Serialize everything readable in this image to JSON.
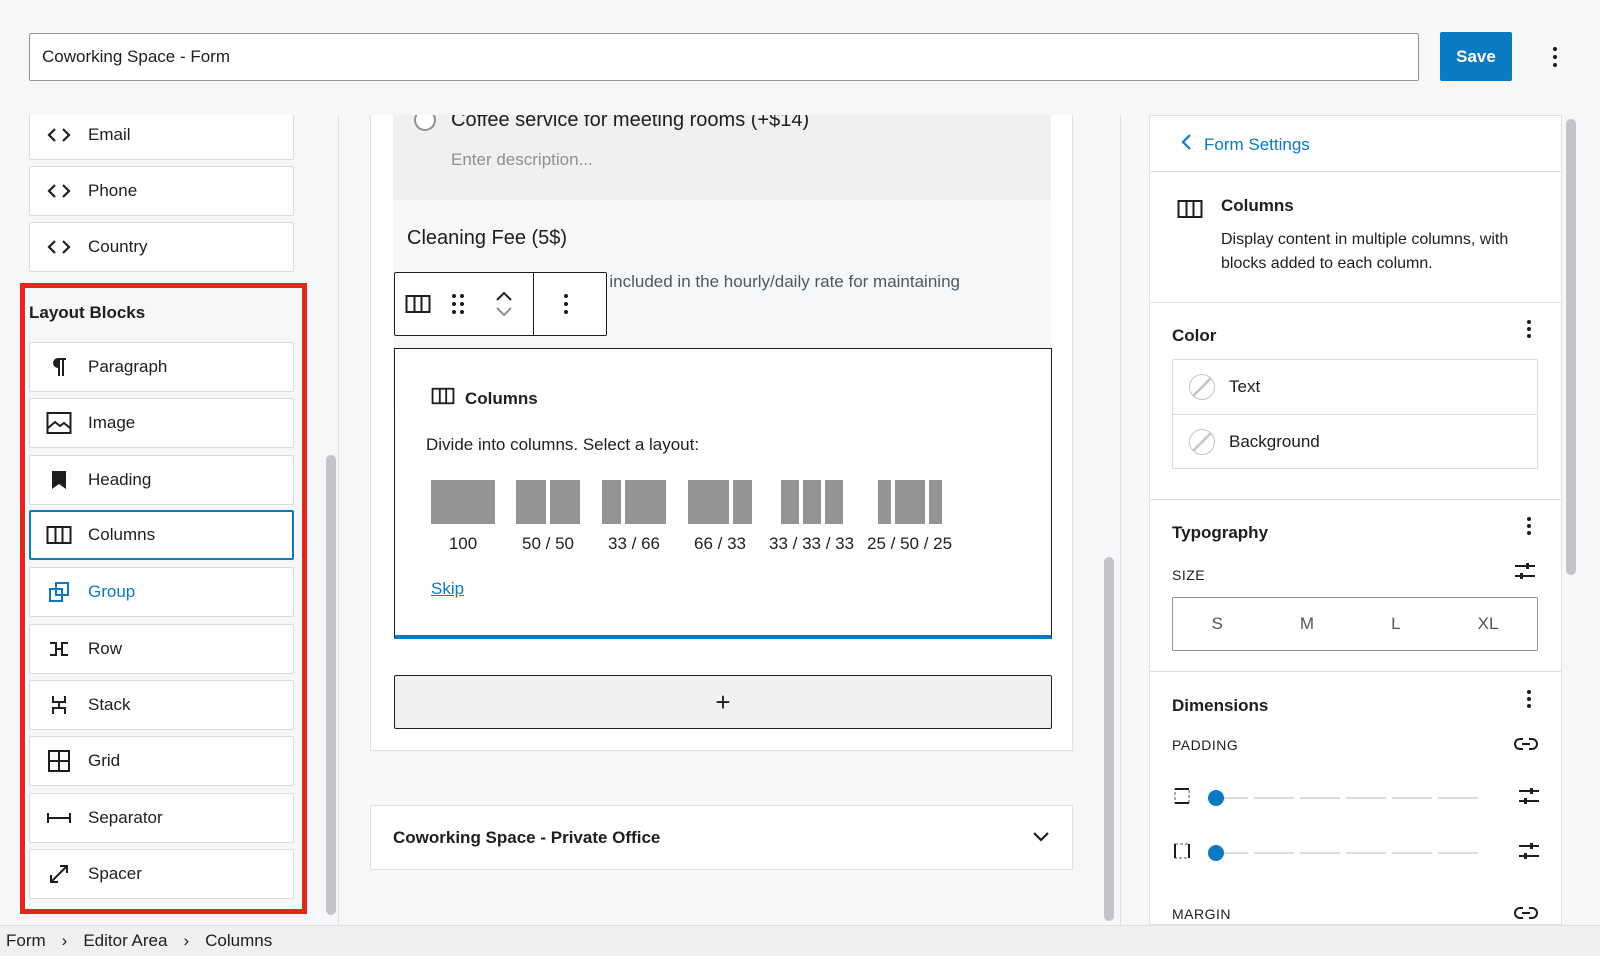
{
  "header": {
    "title_value": "Coworking Space - Form",
    "save_label": "Save"
  },
  "sidebar": {
    "top_items": [
      {
        "label": "Email",
        "icon": "code-icon"
      },
      {
        "label": "Phone",
        "icon": "code-icon"
      },
      {
        "label": "Country",
        "icon": "code-icon"
      }
    ],
    "layout_heading": "Layout Blocks",
    "layout_items": [
      {
        "label": "Paragraph",
        "icon": "paragraph-icon"
      },
      {
        "label": "Image",
        "icon": "image-icon"
      },
      {
        "label": "Heading",
        "icon": "heading-icon"
      },
      {
        "label": "Columns",
        "icon": "columns-icon"
      },
      {
        "label": "Group",
        "icon": "group-icon"
      },
      {
        "label": "Row",
        "icon": "row-icon"
      },
      {
        "label": "Stack",
        "icon": "stack-icon"
      },
      {
        "label": "Grid",
        "icon": "grid-icon"
      },
      {
        "label": "Separator",
        "icon": "separator-icon"
      },
      {
        "label": "Spacer",
        "icon": "spacer-icon"
      }
    ]
  },
  "canvas": {
    "option_label": "Coffee service for meeting rooms (+$14)",
    "description_placeholder": "Enter description...",
    "cleaning_title": "Cleaning Fee (5$)",
    "cleaning_desc": "r included in the hourly/daily rate for maintaining",
    "columns_block": {
      "title": "Columns",
      "instruction": "Divide into columns. Select a layout:",
      "layouts": [
        "100",
        "50 / 50",
        "33 / 66",
        "66 / 33",
        "33 / 33 / 33",
        "25 / 50 / 25"
      ],
      "skip_label": "Skip"
    },
    "add_symbol": "+",
    "collapsed_form": "Coworking Space - Private Office"
  },
  "settings": {
    "back_label": "Form Settings",
    "block_title": "Columns",
    "block_desc": "Display content in multiple columns, with blocks added to each column.",
    "color_title": "Color",
    "color_items": [
      "Text",
      "Background"
    ],
    "typography_title": "Typography",
    "size_label": "SIZE",
    "sizes": [
      "S",
      "M",
      "L",
      "XL"
    ],
    "dimensions_title": "Dimensions",
    "padding_label": "PADDING",
    "margin_label": "MARGIN"
  },
  "breadcrumb": [
    "Form",
    "Editor Area",
    "Columns"
  ],
  "colors": {
    "accent": "#0a7ac2",
    "highlight": "#e3281b"
  }
}
